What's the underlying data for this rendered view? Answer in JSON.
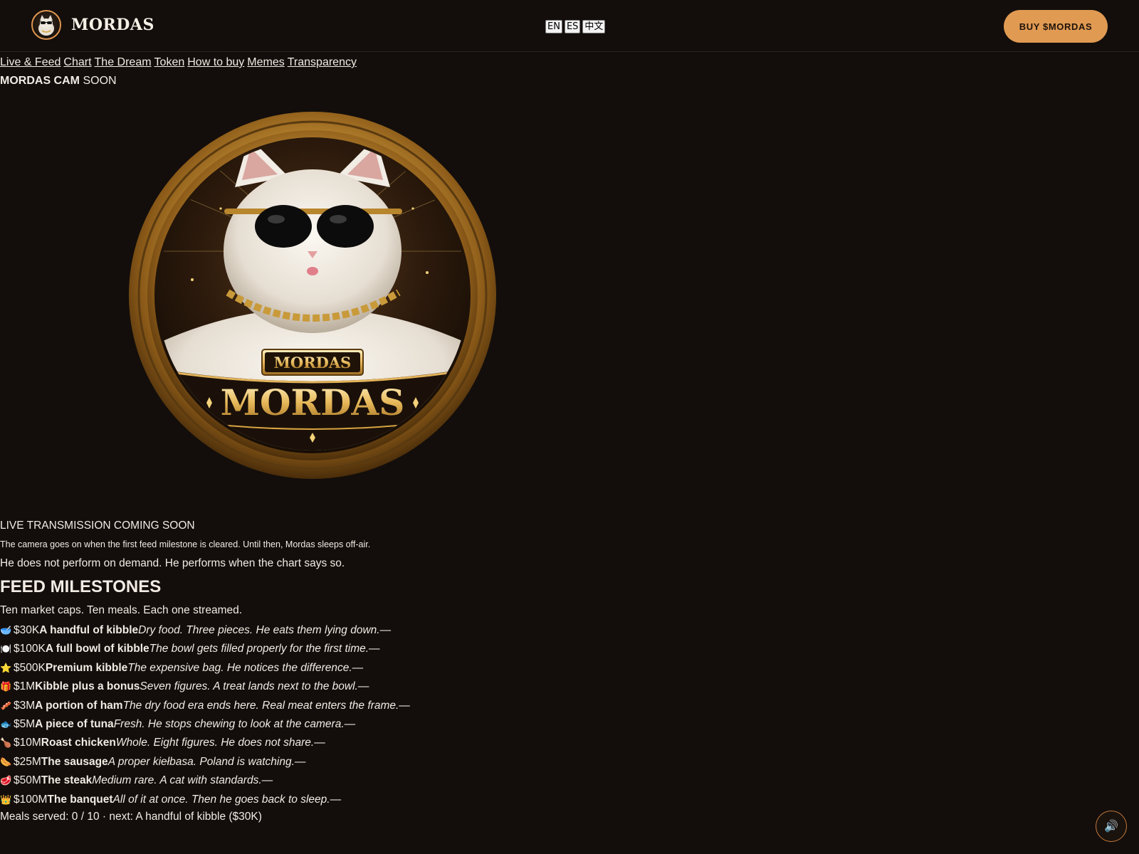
{
  "header": {
    "logo_text": "MORDAS",
    "languages": [
      "EN",
      "ES",
      "中文"
    ],
    "buy_label": "BUY $MORDAS"
  },
  "nav": {
    "links": [
      "Live & Feed",
      "Chart",
      "The Dream",
      "Token",
      "How to buy",
      "Memes",
      "Transparency"
    ]
  },
  "cam": {
    "title_bold": "MORDAS CAM",
    "title_status": "SOON",
    "coin_badge_text": "MORDAS",
    "coin_main_text": "MORDAS",
    "status": "LIVE TRANSMISSION COMING SOON",
    "note": "The camera goes on when the first feed milestone is cleared. Until then, Mordas sleeps off-air.",
    "line": "He does not perform on demand. He performs when the chart says so."
  },
  "feed": {
    "title": "FEED MILESTONES",
    "subtitle": "Ten market caps. Ten meals. Each one streamed.",
    "milestones": [
      {
        "emoji": "🥣",
        "cap": "$30K",
        "name": "A handful of kibble",
        "desc": "Dry food. Three pieces. He eats them lying down.",
        "status": "—"
      },
      {
        "emoji": "🍽️",
        "cap": "$100K",
        "name": "A full bowl of kibble",
        "desc": "The bowl gets filled properly for the first time.",
        "status": "—"
      },
      {
        "emoji": "⭐",
        "cap": "$500K",
        "name": "Premium kibble",
        "desc": "The expensive bag. He notices the difference.",
        "status": "—"
      },
      {
        "emoji": "🎁",
        "cap": "$1M",
        "name": "Kibble plus a bonus",
        "desc": "Seven figures. A treat lands next to the bowl.",
        "status": "—"
      },
      {
        "emoji": "🥓",
        "cap": "$3M",
        "name": "A portion of ham",
        "desc": "The dry food era ends here. Real meat enters the frame.",
        "status": "—"
      },
      {
        "emoji": "🐟",
        "cap": "$5M",
        "name": "A piece of tuna",
        "desc": "Fresh. He stops chewing to look at the camera.",
        "status": "—"
      },
      {
        "emoji": "🍗",
        "cap": "$10M",
        "name": "Roast chicken",
        "desc": "Whole. Eight figures. He does not share.",
        "status": "—"
      },
      {
        "emoji": "🌭",
        "cap": "$25M",
        "name": "The sausage",
        "desc": "A proper kiełbasa. Poland is watching.",
        "status": "—"
      },
      {
        "emoji": "🥩",
        "cap": "$50M",
        "name": "The steak",
        "desc": "Medium rare. A cat with standards.",
        "status": "—"
      },
      {
        "emoji": "👑",
        "cap": "$100M",
        "name": "The banquet",
        "desc": "All of it at once. Then he goes back to sleep.",
        "status": "—"
      }
    ],
    "meals_served": "Meals served: 0 / 10 · next: A handful of kibble ($30K)"
  },
  "sound": {
    "icon": "speaker-icon",
    "glyph": "🔊"
  },
  "colors": {
    "background": "#130e0b",
    "accent": "#e09a52",
    "gold": "#d9a441",
    "text": "#f2ebe4"
  }
}
